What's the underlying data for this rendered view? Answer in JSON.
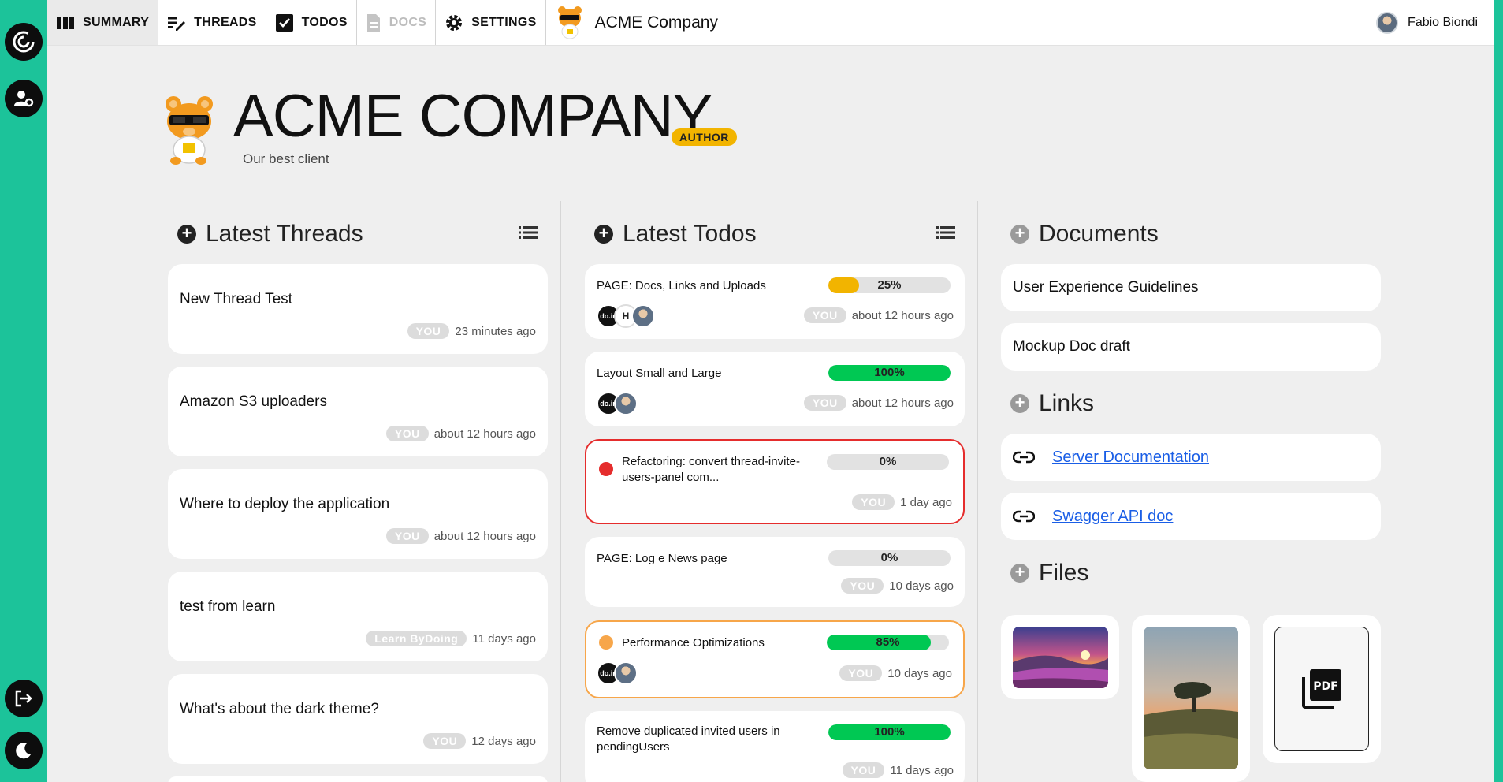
{
  "nav": {
    "tabs": [
      {
        "label": "SUMMARY",
        "icon": "columns-icon",
        "active": true
      },
      {
        "label": "THREADS",
        "icon": "edit-lines-icon"
      },
      {
        "label": "TODOS",
        "icon": "checkbox-icon"
      },
      {
        "label": "DOCS",
        "icon": "document-icon",
        "disabled": true
      },
      {
        "label": "SETTINGS",
        "icon": "gear-icon"
      }
    ],
    "brand_name": "ACME Company",
    "user_name": "Fabio Biondi"
  },
  "header": {
    "title": "ACME COMPANY",
    "badge": "AUTHOR",
    "subtitle": "Our best client"
  },
  "threads": {
    "heading": "Latest Threads",
    "items": [
      {
        "title": "New Thread Test",
        "author": "YOU",
        "time": "23 minutes ago"
      },
      {
        "title": "Amazon S3 uploaders",
        "author": "YOU",
        "time": "about 12 hours ago"
      },
      {
        "title": "Where to deploy the application",
        "author": "YOU",
        "time": "about 12 hours ago"
      },
      {
        "title": "test from learn",
        "author": "Learn ByDoing",
        "time": "11 days ago"
      },
      {
        "title": "What's about the dark theme?",
        "author": "YOU",
        "time": "12 days ago"
      }
    ]
  },
  "todos": {
    "heading": "Latest Todos",
    "items": [
      {
        "title": "PAGE: Docs, Links and Uploads",
        "progress": 25,
        "progress_label": "25%",
        "author": "YOU",
        "time": "about 12 hours ago"
      },
      {
        "title": "Layout Small and Large",
        "progress": 100,
        "progress_label": "100%",
        "author": "YOU",
        "time": "about 12 hours ago"
      },
      {
        "title": "Refactoring: convert thread-invite-users-panel com...",
        "progress": 0,
        "progress_label": "0%",
        "author": "YOU",
        "time": "1 day ago",
        "priority": "high"
      },
      {
        "title": "PAGE: Log e News page",
        "progress": 0,
        "progress_label": "0%",
        "author": "YOU",
        "time": "10 days ago"
      },
      {
        "title": "Performance Optimizations",
        "progress": 85,
        "progress_label": "85%",
        "author": "YOU",
        "time": "10 days ago",
        "priority": "medium"
      },
      {
        "title": "Remove duplicated invited users in pendingUsers",
        "progress": 100,
        "progress_label": "100%",
        "author": "YOU",
        "time": "11 days ago"
      }
    ],
    "avatar_labels": {
      "dark": "do.in",
      "letter": "H"
    }
  },
  "documents": {
    "heading": "Documents",
    "items": [
      "User Experience Guidelines",
      "Mockup Doc draft"
    ]
  },
  "links": {
    "heading": "Links",
    "items": [
      "Server Documentation",
      "Swagger API doc"
    ]
  },
  "files": {
    "heading": "Files",
    "pdf_label": "PDF"
  },
  "colors": {
    "accent": "#1cc39a",
    "progress_green": "#00c853",
    "progress_yellow": "#f2b400",
    "priority_high": "#e52d2d",
    "priority_medium": "#f7a64a",
    "link": "#1a5ee6",
    "badge": "#f2b400"
  }
}
